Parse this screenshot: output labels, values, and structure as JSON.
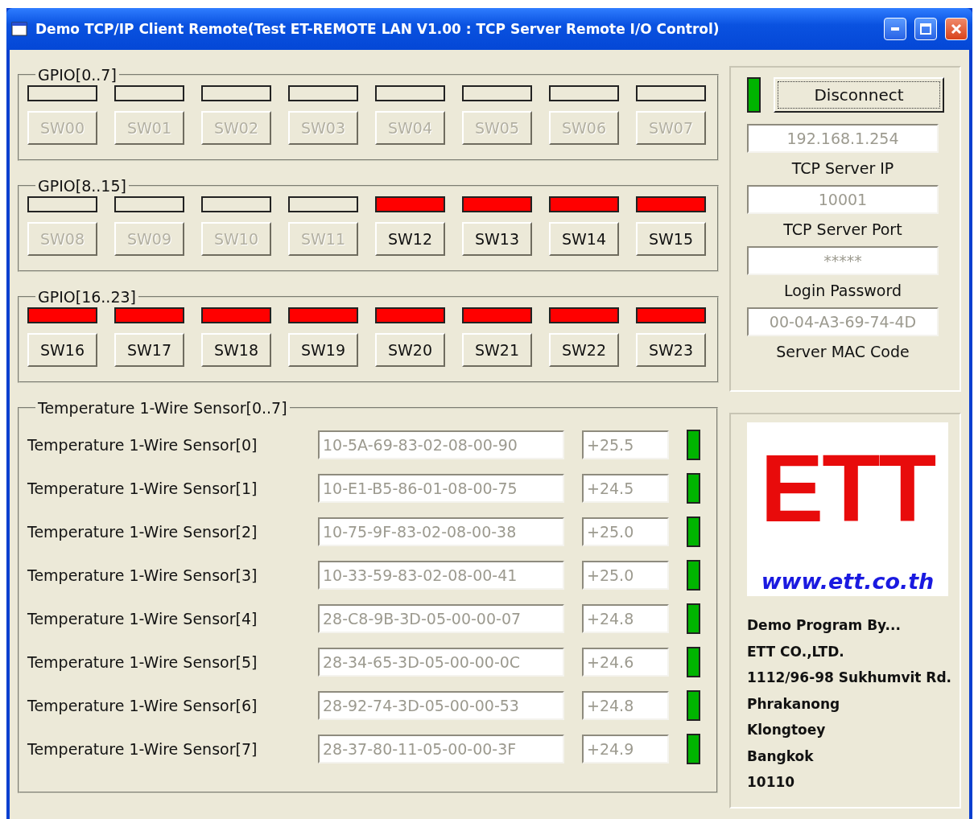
{
  "window": {
    "title": "Demo TCP/IP Client  Remote(Test ET-REMOTE LAN V1.00 : TCP Server Remote I/O Control)"
  },
  "gpio_groups": [
    {
      "title": "GPIO[0..7]",
      "switches": [
        {
          "label": "SW00",
          "on": false,
          "disabled": true
        },
        {
          "label": "SW01",
          "on": false,
          "disabled": true
        },
        {
          "label": "SW02",
          "on": false,
          "disabled": true
        },
        {
          "label": "SW03",
          "on": false,
          "disabled": true
        },
        {
          "label": "SW04",
          "on": false,
          "disabled": true
        },
        {
          "label": "SW05",
          "on": false,
          "disabled": true
        },
        {
          "label": "SW06",
          "on": false,
          "disabled": true
        },
        {
          "label": "SW07",
          "on": false,
          "disabled": true
        }
      ]
    },
    {
      "title": "GPIO[8..15]",
      "switches": [
        {
          "label": "SW08",
          "on": false,
          "disabled": true
        },
        {
          "label": "SW09",
          "on": false,
          "disabled": true
        },
        {
          "label": "SW10",
          "on": false,
          "disabled": true
        },
        {
          "label": "SW11",
          "on": false,
          "disabled": true
        },
        {
          "label": "SW12",
          "on": true,
          "disabled": false
        },
        {
          "label": "SW13",
          "on": true,
          "disabled": false
        },
        {
          "label": "SW14",
          "on": true,
          "disabled": false
        },
        {
          "label": "SW15",
          "on": true,
          "disabled": false
        }
      ]
    },
    {
      "title": "GPIO[16..23]",
      "switches": [
        {
          "label": "SW16",
          "on": true,
          "disabled": false
        },
        {
          "label": "SW17",
          "on": true,
          "disabled": false
        },
        {
          "label": "SW18",
          "on": true,
          "disabled": false
        },
        {
          "label": "SW19",
          "on": true,
          "disabled": false
        },
        {
          "label": "SW20",
          "on": true,
          "disabled": false
        },
        {
          "label": "SW21",
          "on": true,
          "disabled": false
        },
        {
          "label": "SW22",
          "on": true,
          "disabled": false
        },
        {
          "label": "SW23",
          "on": true,
          "disabled": false
        }
      ]
    }
  ],
  "connection": {
    "connected": true,
    "button": "Disconnect",
    "fields": [
      {
        "value": "192.168.1.254",
        "label": "TCP Server IP"
      },
      {
        "value": "10001",
        "label": "TCP Server Port"
      },
      {
        "value": "*****",
        "label": "Login Password"
      },
      {
        "value": "00-04-A3-69-74-4D",
        "label": "Server MAC Code"
      }
    ]
  },
  "sensors": {
    "title": "Temperature 1-Wire Sensor[0..7]",
    "rows": [
      {
        "label": "Temperature 1-Wire Sensor[0]",
        "rom": "10-5A-69-83-02-08-00-90",
        "reading": "+25.5",
        "ok": true
      },
      {
        "label": "Temperature 1-Wire Sensor[1]",
        "rom": "10-E1-B5-86-01-08-00-75",
        "reading": "+24.5",
        "ok": true
      },
      {
        "label": "Temperature 1-Wire Sensor[2]",
        "rom": "10-75-9F-83-02-08-00-38",
        "reading": "+25.0",
        "ok": true
      },
      {
        "label": "Temperature 1-Wire Sensor[3]",
        "rom": "10-33-59-83-02-08-00-41",
        "reading": "+25.0",
        "ok": true
      },
      {
        "label": "Temperature 1-Wire Sensor[4]",
        "rom": "28-C8-9B-3D-05-00-00-07",
        "reading": "+24.8",
        "ok": true
      },
      {
        "label": "Temperature 1-Wire Sensor[5]",
        "rom": "28-34-65-3D-05-00-00-0C",
        "reading": "+24.6",
        "ok": true
      },
      {
        "label": "Temperature 1-Wire Sensor[6]",
        "rom": "28-92-74-3D-05-00-00-53",
        "reading": "+24.8",
        "ok": true
      },
      {
        "label": "Temperature 1-Wire Sensor[7]",
        "rom": "28-37-80-11-05-00-00-3F",
        "reading": "+24.9",
        "ok": true
      }
    ]
  },
  "about": {
    "logo": "ETT",
    "url": "www.ett.co.th",
    "lines": [
      "Demo Program By...",
      "ETT CO.,LTD.",
      "1112/96-98 Sukhumvit Rd.",
      "Phrakanong",
      "Klongtoey",
      "Bangkok",
      "10110"
    ]
  }
}
